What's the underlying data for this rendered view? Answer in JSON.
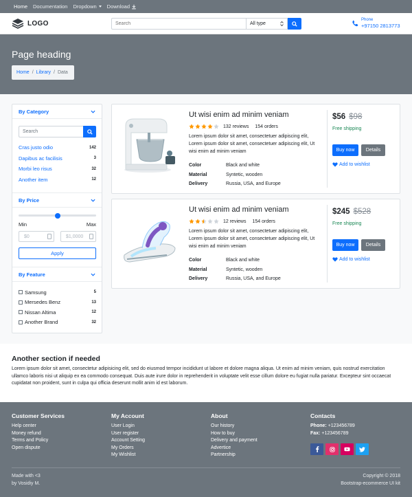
{
  "topnav": {
    "items": [
      {
        "label": "Home"
      },
      {
        "label": "Documentation"
      },
      {
        "label": "Dropdown"
      },
      {
        "label": "Download"
      }
    ]
  },
  "header": {
    "logo_text": "LOGO",
    "search_placeholder": "Search",
    "type_select": "All type",
    "phone_label": "Phone",
    "phone_number": "+97150 2813773"
  },
  "page": {
    "heading": "Page heading",
    "breadcrumb": [
      "Home",
      "Library",
      "Data"
    ]
  },
  "sidebar": {
    "category": {
      "title": "By Category",
      "search_placeholder": "Search",
      "items": [
        {
          "name": "Cras justo odio",
          "count": "142"
        },
        {
          "name": "Dapibus ac facilisis",
          "count": "3"
        },
        {
          "name": "Morbi leo risus",
          "count": "32"
        },
        {
          "name": "Another item",
          "count": "12"
        }
      ]
    },
    "price": {
      "title": "By Price",
      "slider_value": 0.5,
      "min_label": "Min",
      "max_label": "Max",
      "min_placeholder": "$0",
      "max_placeholder": "$1,0000",
      "apply_label": "Apply"
    },
    "feature": {
      "title": "By Feature",
      "items": [
        {
          "name": "Samsung",
          "count": "5"
        },
        {
          "name": "Mersedes Benz",
          "count": "13"
        },
        {
          "name": "Nissan Altima",
          "count": "12"
        },
        {
          "name": "Another Brand",
          "count": "32"
        }
      ]
    }
  },
  "products": [
    {
      "title": "Ut wisi enim ad minim veniam",
      "rating": 4,
      "reviews": "132 reviews",
      "orders": "154 orders",
      "description": "Lorem ipsum dolor sit amet, consectetuer adipiscing elit, Lorem ipsum dolor sit amet, consectetuer adipiscing elit, Ut wisi enim ad minim veniam",
      "specs": [
        {
          "key": "Color",
          "value": "Black and white"
        },
        {
          "key": "Material",
          "value": "Syntetic, wooden"
        },
        {
          "key": "Delivery",
          "value": "Russia, USA, and Europe"
        }
      ],
      "price": "$56",
      "old_price": "$98",
      "shipping": "Free shipping",
      "buy_label": "Buy now",
      "details_label": "Details",
      "wishlist_label": "Add to wishlist",
      "image_icon": "stand-mixer-icon"
    },
    {
      "title": "Ut wisi enim ad minim veniam",
      "rating": 2.5,
      "reviews": "12 reviews",
      "orders": "154 orders",
      "description": "Lorem ipsum dolor sit amet, consectetuer adipiscing elit, Lorem ipsum dolor sit amet, consectetuer adipiscing elit, Ut wisi enim ad minim veniam",
      "specs": [
        {
          "key": "Color",
          "value": "Black and white"
        },
        {
          "key": "Material",
          "value": "Syntetic, wooden"
        },
        {
          "key": "Delivery",
          "value": "Russia, USA, and Europe"
        }
      ],
      "price": "$245",
      "old_price": "$528",
      "shipping": "Free shipping",
      "buy_label": "Buy now",
      "details_label": "Details",
      "wishlist_label": "Add to wishlist",
      "image_icon": "steam-iron-icon"
    }
  ],
  "another": {
    "title": "Another section if needed",
    "text": "Lorem ipsum dolor sit amet, consectetur adipisicing elit, sed do eiusmod tempor incididunt ut labore et dolore magna aliqua. Ut enim ad minim veniam, quis nostrud exercitation ullamco laboris nisi ut aliquip ex ea commodo consequat. Duis aute irure dolor in reprehenderit in voluptate velit esse cillum dolore eu fugiat nulla pariatur. Excepteur sint occaecat cupidatat non proident, sunt in culpa qui officia deserunt mollit anim id est laborum."
  },
  "footer": {
    "customer": {
      "title": "Customer Services",
      "links": [
        "Help center",
        "Money refund",
        "Terms and Policy",
        "Open dispute"
      ]
    },
    "account": {
      "title": "My Account",
      "links": [
        "User Login",
        "User register",
        "Account Setting",
        "My Orders",
        "My Wishlist"
      ]
    },
    "about": {
      "title": "About",
      "links": [
        "Our history",
        "How to buy",
        "Delivery and payment",
        "Advertice",
        "Partnership"
      ]
    },
    "contacts": {
      "title": "Contacts",
      "phone_label": "Phone:",
      "phone": "+123456789",
      "fax_label": "Fax:",
      "fax": "+123456789"
    },
    "made_with": "Made with <3",
    "made_by": "by Vosidiy M.",
    "copyright": "Copyright © 2018",
    "kit": "Bootstrap-ecommerce UI kit",
    "social_colors": {
      "facebook": "#3b5998",
      "instagram": "#e1306c",
      "youtube": "#d6005f",
      "twitter": "#1da1f2"
    }
  },
  "colors": {
    "primary": "#0d6efd",
    "secondary": "#6c757d",
    "success": "#198754",
    "star": "#ff9800"
  }
}
